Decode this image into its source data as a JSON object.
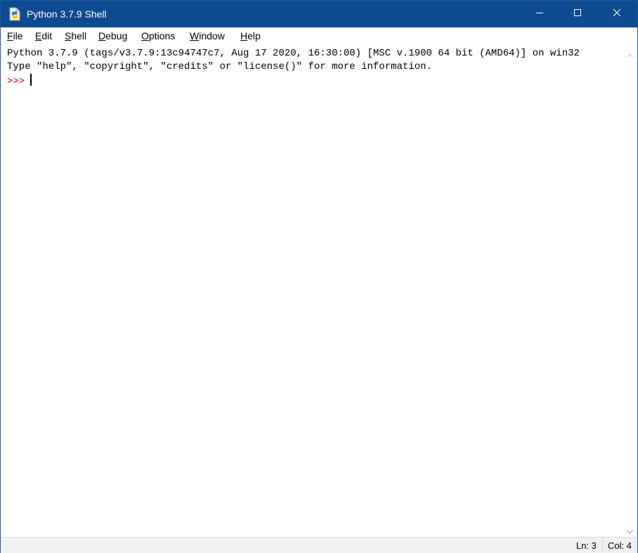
{
  "window": {
    "title": "Python 3.7.9 Shell",
    "icon": "python-idle-icon",
    "controls": {
      "minimize_icon": "minimize-icon",
      "maximize_icon": "maximize-icon",
      "close_icon": "close-icon"
    },
    "titlebar_color": "#0d4a8f"
  },
  "menubar": {
    "items": [
      "File",
      "Edit",
      "Shell",
      "Debug",
      "Options",
      "Window",
      "Help"
    ]
  },
  "shell": {
    "lines": [
      "Python 3.7.9 (tags/v3.7.9:13c94747c7, Aug 17 2020, 16:30:00) [MSC v.1900 64 bit (AMD64)] on win32",
      "Type \"help\", \"copyright\", \"credits\" or \"license()\" for more information."
    ],
    "prompt": ">>>",
    "prompt_color": "#c00000"
  },
  "statusbar": {
    "ln": "Ln: 3",
    "col": "Col: 4"
  }
}
